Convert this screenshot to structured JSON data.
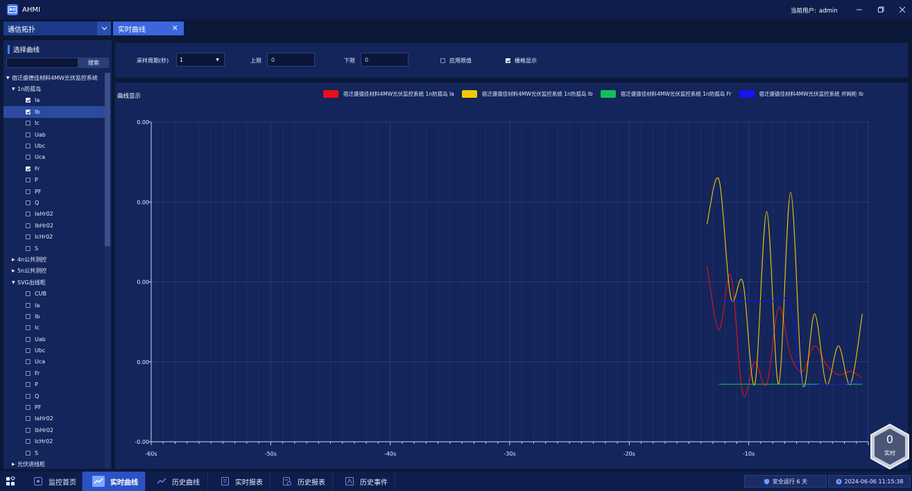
{
  "app": {
    "title": "AHMI",
    "user_label": "当前用户:",
    "user_name": "admin"
  },
  "tabs": {
    "dropdown_label": "通信拓扑",
    "active_tab": "实时曲线"
  },
  "sidebar": {
    "title": "选择曲线",
    "search_button": "搜索",
    "tree": [
      {
        "label": "宿迁盛德佳材料4MW光伏监控系统",
        "level": 0,
        "type": "group",
        "expanded": true
      },
      {
        "label": "1n防孤岛",
        "level": 1,
        "type": "group",
        "expanded": true
      },
      {
        "label": "Ia",
        "level": 2,
        "type": "leaf",
        "checked": true
      },
      {
        "label": "Ib",
        "level": 2,
        "type": "leaf",
        "checked": true,
        "selected": true
      },
      {
        "label": "Ic",
        "level": 2,
        "type": "leaf",
        "checked": false
      },
      {
        "label": "Uab",
        "level": 2,
        "type": "leaf",
        "checked": false
      },
      {
        "label": "Ubc",
        "level": 2,
        "type": "leaf",
        "checked": false
      },
      {
        "label": "Uca",
        "level": 2,
        "type": "leaf",
        "checked": false
      },
      {
        "label": "Fr",
        "level": 2,
        "type": "leaf",
        "checked": true
      },
      {
        "label": "P",
        "level": 2,
        "type": "leaf",
        "checked": false
      },
      {
        "label": "PF",
        "level": 2,
        "type": "leaf",
        "checked": false
      },
      {
        "label": "Q",
        "level": 2,
        "type": "leaf",
        "checked": false
      },
      {
        "label": "IaHr02",
        "level": 2,
        "type": "leaf",
        "checked": false
      },
      {
        "label": "IbHr02",
        "level": 2,
        "type": "leaf",
        "checked": false
      },
      {
        "label": "IcHr02",
        "level": 2,
        "type": "leaf",
        "checked": false
      },
      {
        "label": "S",
        "level": 2,
        "type": "leaf",
        "checked": false
      },
      {
        "label": "4n公共测控",
        "level": 1,
        "type": "group",
        "expanded": false
      },
      {
        "label": "5n公共测控",
        "level": 1,
        "type": "group",
        "expanded": false
      },
      {
        "label": "SVG出线柜",
        "level": 1,
        "type": "group",
        "expanded": true
      },
      {
        "label": "CUB",
        "level": 2,
        "type": "leaf",
        "checked": false
      },
      {
        "label": "Ia",
        "level": 2,
        "type": "leaf",
        "checked": false
      },
      {
        "label": "Ib",
        "level": 2,
        "type": "leaf",
        "checked": false
      },
      {
        "label": "Ic",
        "level": 2,
        "type": "leaf",
        "checked": false
      },
      {
        "label": "Uab",
        "level": 2,
        "type": "leaf",
        "checked": false
      },
      {
        "label": "Ubc",
        "level": 2,
        "type": "leaf",
        "checked": false
      },
      {
        "label": "Uca",
        "level": 2,
        "type": "leaf",
        "checked": false
      },
      {
        "label": "Fr",
        "level": 2,
        "type": "leaf",
        "checked": false
      },
      {
        "label": "P",
        "level": 2,
        "type": "leaf",
        "checked": false
      },
      {
        "label": "Q",
        "level": 2,
        "type": "leaf",
        "checked": false
      },
      {
        "label": "PF",
        "level": 2,
        "type": "leaf",
        "checked": false
      },
      {
        "label": "IaHr02",
        "level": 2,
        "type": "leaf",
        "checked": false
      },
      {
        "label": "IbHr02",
        "level": 2,
        "type": "leaf",
        "checked": false
      },
      {
        "label": "IcHr02",
        "level": 2,
        "type": "leaf",
        "checked": false
      },
      {
        "label": "S",
        "level": 2,
        "type": "leaf",
        "checked": false
      },
      {
        "label": "光伏进线柜",
        "level": 1,
        "type": "group",
        "expanded": false
      }
    ]
  },
  "toolbar": {
    "period_label": "采样周期(秒)",
    "period_value": "1",
    "upper_label": "上限",
    "upper_value": "0",
    "lower_label": "下限",
    "lower_value": "0",
    "apply_limit_label": "应用限值",
    "apply_limit_checked": false,
    "grid_label": "栅格显示",
    "grid_checked": true
  },
  "chart": {
    "panel_title": "曲线显示",
    "legend": [
      {
        "label": "宿迁盛德佳材料4MW光伏监控系统 1n防孤岛 Ia",
        "color": "#e8101a"
      },
      {
        "label": "宿迁盛德佳材料4MW光伏监控系统 1n防孤岛 Ib",
        "color": "#f5c800"
      },
      {
        "label": "宿迁盛德佳材料4MW光伏监控系统 1n防孤岛 Fr",
        "color": "#13c058"
      },
      {
        "label": "宿迁盛德佳材料4MW光伏监控系统 并网柜 Ib",
        "color": "#1414ee"
      }
    ]
  },
  "chart_data": {
    "type": "line",
    "x_ticks": [
      -60,
      -50,
      -40,
      -30,
      -20,
      -10
    ],
    "x_tick_labels": [
      "-60s",
      "-50s",
      "-40s",
      "-30s",
      "-20s",
      "-10s"
    ],
    "y_tick_labels": [
      "0.00",
      "0.00",
      "0.00",
      "0.00",
      "-0.00"
    ],
    "xlim": [
      -60,
      0
    ],
    "grid": true,
    "series": [
      {
        "name": "宿迁盛德佳材料4MW光伏监控系统 1n防孤岛 Ia",
        "color": "#e8101a",
        "x": [
          -13.5,
          -12.5,
          -11.5,
          -10.5,
          -9.5,
          -8.5,
          -7.5,
          -6.5,
          -5.5,
          -4.5,
          -3.5,
          -2.5,
          -1.5,
          -0.5
        ],
        "y": [
          0.55,
          0.35,
          0.52,
          0.15,
          0.25,
          0.18,
          0.42,
          0.27,
          0.22,
          0.3,
          0.24,
          0.21,
          0.22,
          0.2
        ]
      },
      {
        "name": "宿迁盛德佳材料4MW光伏监控系统 1n防孤岛 Ib",
        "color": "#f5c800",
        "x": [
          -13.5,
          -12.5,
          -11.5,
          -10.5,
          -9.5,
          -8.5,
          -7.5,
          -6.5,
          -5.5,
          -4.5,
          -3.5,
          -2.5,
          -1.5,
          -0.5
        ],
        "y": [
          0.68,
          0.82,
          0.45,
          0.5,
          0.18,
          0.72,
          0.18,
          0.78,
          0.18,
          0.4,
          0.18,
          0.3,
          0.18,
          0.4
        ]
      },
      {
        "name": "宿迁盛德佳材料4MW光伏监控系统 1n防孤岛 Fr",
        "color": "#13c058",
        "x": [
          -12.5,
          -0.5
        ],
        "y": [
          0.18,
          0.18
        ]
      },
      {
        "name": "宿迁盛德佳材料4MW光伏监控系统 并网柜 Ib",
        "color": "#1414ee",
        "x": [
          -12.5,
          -10.0,
          -8.0,
          -7.0,
          -6.5,
          -6.0,
          -5.5,
          -4.0,
          -2.0,
          -0.5
        ],
        "y": [
          0.44,
          0.44,
          0.44,
          0.45,
          0.43,
          0.3,
          0.17,
          0.18,
          0.18,
          0.19
        ]
      }
    ]
  },
  "badge": {
    "value": "0",
    "label": "实时"
  },
  "bottom_nav": {
    "items": [
      {
        "label": "监控首页",
        "active": false
      },
      {
        "label": "实时曲线",
        "active": true
      },
      {
        "label": "历史曲线",
        "active": false
      },
      {
        "label": "实时报表",
        "active": false
      },
      {
        "label": "历史报表",
        "active": false
      },
      {
        "label": "历史事件",
        "active": false
      }
    ],
    "safe_running": "安全运行 6 天",
    "datetime": "2024-06-06 11:15:38"
  }
}
